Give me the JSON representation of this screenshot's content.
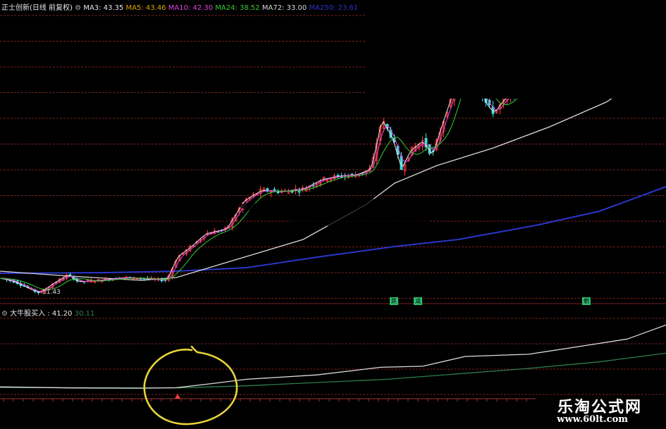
{
  "colors": {
    "background": "#000000",
    "grid": "#7a1f1f",
    "up": "#ff3b3b",
    "down": "#40e0e0",
    "ma3": "#e8e8e8",
    "ma5": "#d9a400",
    "ma10": "#e040e0",
    "ma24": "#33cc33",
    "ma72": "#d8d8d8",
    "ma250": "#2a36c8",
    "ind1": "#dcdcdc",
    "ind2": "#2e7d4f",
    "circle": "#e8d43a"
  },
  "header": {
    "title": "正士创新(日线 前复权)",
    "ma3": "MA3: 43.35",
    "ma5": "MA5: 43.46",
    "ma10": "MA10: 42.30",
    "ma24": "MA24: 38.52",
    "ma72": "MA72: 33.00",
    "ma250": "MA250: 23.61"
  },
  "low_label": "11.43",
  "tags": {
    "t1": "跌",
    "t2": "减",
    "t3": "朝"
  },
  "indicator_header": {
    "title": "大牛股买入",
    "value1": ": 41.20",
    "value2": "30.11"
  },
  "watermark": {
    "line1": "乐淘公式网",
    "line2": "www.60lt.com"
  },
  "chart_data": [
    {
      "type": "candlestick",
      "title": "正士创新(日线 前复权)",
      "series": [
        {
          "name": "MA3",
          "last": 43.35
        },
        {
          "name": "MA5",
          "last": 43.46
        },
        {
          "name": "MA10",
          "last": 42.3
        },
        {
          "name": "MA24",
          "last": 38.52
        },
        {
          "name": "MA72",
          "last": 33.0
        },
        {
          "name": "MA250",
          "last": 23.61
        }
      ],
      "price_path": [
        [
          0,
          13.5
        ],
        [
          20,
          13.0
        ],
        [
          45,
          11.8
        ],
        [
          55,
          11.43
        ],
        [
          75,
          12.8
        ],
        [
          95,
          14.0
        ],
        [
          110,
          13.0
        ],
        [
          140,
          13.2
        ],
        [
          175,
          13.6
        ],
        [
          210,
          13.4
        ],
        [
          235,
          13.2
        ],
        [
          250,
          16.5
        ],
        [
          270,
          18.0
        ],
        [
          290,
          19.8
        ],
        [
          320,
          20.5
        ],
        [
          345,
          24.5
        ],
        [
          370,
          26.0
        ],
        [
          400,
          25.8
        ],
        [
          430,
          26.2
        ],
        [
          455,
          27.5
        ],
        [
          480,
          28.0
        ],
        [
          505,
          28.2
        ],
        [
          525,
          29.0
        ],
        [
          540,
          36.0
        ],
        [
          555,
          33.5
        ],
        [
          568,
          29.0
        ],
        [
          580,
          31.5
        ],
        [
          598,
          33.0
        ],
        [
          612,
          31.0
        ],
        [
          628,
          36.0
        ],
        [
          645,
          41.0
        ],
        [
          660,
          46.5
        ],
        [
          672,
          42.0
        ],
        [
          690,
          38.0
        ],
        [
          700,
          37.0
        ],
        [
          715,
          39.0
        ],
        [
          735,
          40.5
        ],
        [
          755,
          40.0
        ],
        [
          765,
          41.5
        ],
        [
          780,
          41.0
        ],
        [
          795,
          40.0
        ],
        [
          808,
          45.5
        ],
        [
          825,
          44.0
        ],
        [
          840,
          44.5
        ],
        [
          855,
          45.5
        ],
        [
          870,
          45.0
        ]
      ],
      "ma_paths": {
        "MA72": [
          [
            0,
            14.5
          ],
          [
            100,
            13.8
          ],
          [
            200,
            13.2
          ],
          [
            250,
            13.6
          ],
          [
            330,
            16.0
          ],
          [
            430,
            19.0
          ],
          [
            520,
            24.0
          ],
          [
            560,
            27.0
          ],
          [
            620,
            29.5
          ],
          [
            700,
            32.0
          ],
          [
            780,
            35.0
          ],
          [
            860,
            38.5
          ],
          [
            945,
            44.0
          ]
        ],
        "MA250": [
          [
            0,
            14.2
          ],
          [
            150,
            14.3
          ],
          [
            250,
            14.5
          ],
          [
            350,
            15.0
          ],
          [
            450,
            16.5
          ],
          [
            560,
            18.0
          ],
          [
            650,
            19.0
          ],
          [
            760,
            21.0
          ],
          [
            850,
            23.0
          ],
          [
            945,
            26.5
          ]
        ]
      },
      "low_label": 11.43
    },
    {
      "type": "line",
      "title": "大牛股买入",
      "series": [
        {
          "name": "",
          "last": 41.2,
          "path": [
            [
              0,
              3.5
            ],
            [
              100,
              3.0
            ],
            [
              200,
              2.9
            ],
            [
              250,
              3.1
            ],
            [
              300,
              5.0
            ],
            [
              350,
              7.0
            ],
            [
              450,
              9.0
            ],
            [
              540,
              12.5
            ],
            [
              600,
              13.0
            ],
            [
              660,
              17.5
            ],
            [
              750,
              18.5
            ],
            [
              830,
              22.5
            ],
            [
              890,
              25.5
            ],
            [
              945,
              32.0
            ]
          ]
        },
        {
          "name": "",
          "last": 30.11,
          "path": [
            [
              0,
              3.2
            ],
            [
              150,
              3.1
            ],
            [
              250,
              3.0
            ],
            [
              350,
              4.0
            ],
            [
              450,
              5.5
            ],
            [
              550,
              7.0
            ],
            [
              650,
              9.5
            ],
            [
              750,
              12.0
            ],
            [
              850,
              15.0
            ],
            [
              945,
              19.0
            ]
          ]
        }
      ],
      "annotation": "buy-signal-at-x-252"
    }
  ]
}
